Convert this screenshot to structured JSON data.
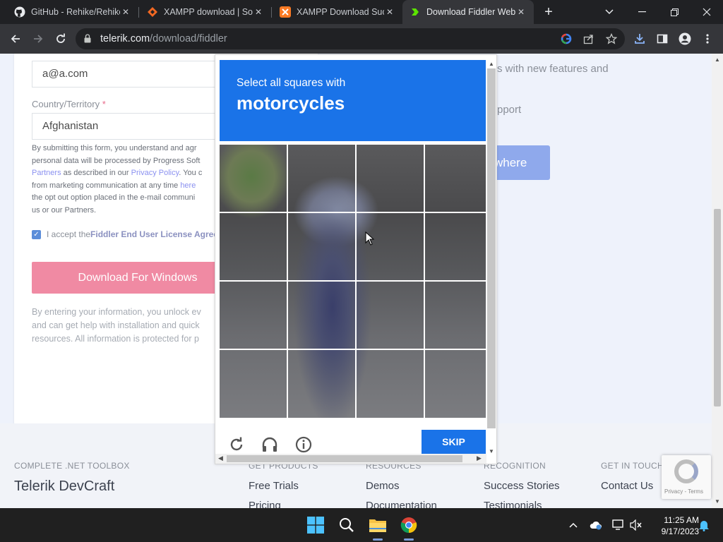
{
  "browser": {
    "tabs": [
      {
        "title": "GitHub - Rehike/Rehike",
        "icon": "github-icon",
        "active": false
      },
      {
        "title": "XAMPP download | Sou",
        "icon": "xampp-sourceforge-icon",
        "active": false
      },
      {
        "title": "XAMPP Download Succ",
        "icon": "xampp-icon",
        "active": false
      },
      {
        "title": "Download Fiddler Web",
        "icon": "fiddler-icon",
        "active": true
      }
    ],
    "url_host": "telerik.com",
    "url_path": "/download/fiddler"
  },
  "form": {
    "email_value": "a@a.com",
    "country_label": "Country/Territory",
    "required_mark": "*",
    "country_value": "Afghanistan",
    "legal_lines": [
      {
        "pre": "By submitting this form, you understand and agr",
        "link": "",
        "post": ""
      },
      {
        "pre": "personal data will be processed by Progress Soft",
        "link": "",
        "post": ""
      },
      {
        "pre": "",
        "link": "Partners",
        "post": " as described in our "
      },
      {
        "pre": "from marketing communication at any time ",
        "link": "here",
        "post": ""
      },
      {
        "pre": "the opt out option placed in the e-mail communi",
        "link": "",
        "post": ""
      },
      {
        "pre": "us or our Partners.",
        "link": "",
        "post": ""
      }
    ],
    "privacy_link": "Privacy Policy",
    "privacy_tail": ". You c",
    "accept_prefix": "I accept the ",
    "accept_link": "Fiddler End User License Agree",
    "download_button": "Download For Windows",
    "info_lines": [
      "By entering your information, you unlock ev",
      "and can get help with installation and quick",
      "resources. All information is protected for p"
    ]
  },
  "right_panel": {
    "line1": "s with new features and",
    "line2": "pport",
    "anywhere_button": "where"
  },
  "footer": {
    "columns": [
      {
        "heading": "COMPLETE .NET TOOLBOX",
        "links": []
      },
      {
        "heading": "GET PRODUCTS",
        "links": [
          "Free Trials",
          "Pricing"
        ]
      },
      {
        "heading": "RESOURCES",
        "links": [
          "Demos",
          "Documentation"
        ]
      },
      {
        "heading": "RECOGNITION",
        "links": [
          "Success Stories",
          "Testimonials"
        ]
      },
      {
        "heading": "GET IN TOUCH",
        "links": [
          "Contact Us"
        ]
      }
    ],
    "brand": "Telerik DevCraft"
  },
  "captcha": {
    "instruction": "Select all squares with",
    "target": "motorcycles",
    "skip_button": "SKIP",
    "accent": "#1a73e8"
  },
  "recaptcha_badge": {
    "text": "Privacy - Terms"
  },
  "taskbar": {
    "time": "11:25 AM",
    "date": "9/17/2023"
  }
}
